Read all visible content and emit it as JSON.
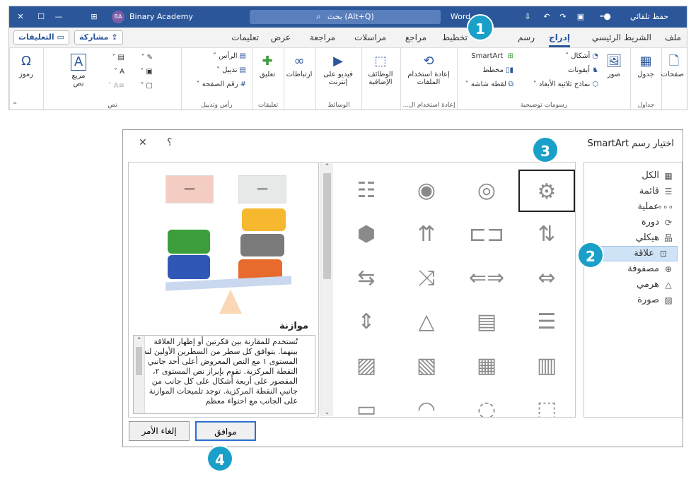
{
  "word": {
    "title_left": "حفظ تلقائي",
    "user_name": "Binary Academy",
    "user_initials": "BA",
    "search_placeholder": "(Alt+Q) بحث",
    "doc_name": "Word",
    "tabs": [
      "ملف",
      "الشريط الرئيسي",
      "إدراج",
      "رسم",
      "تخطيط",
      "مراجع",
      "مراسلات",
      "مراجعة",
      "عرض",
      "تعليمات"
    ],
    "share_label": "مشاركة",
    "comments_label": "التعليقات",
    "groups": {
      "pages": {
        "btn": "صفحات"
      },
      "tables": {
        "btn": "جدول",
        "label": "جداول"
      },
      "illustrations": {
        "pictures": "صور",
        "shapes": "أشكال",
        "icons": "أيقونات",
        "models3d": "نماذج ثلاثية الأبعاد",
        "smartart": "SmartArt",
        "chart": "مخطط",
        "screenshot": "لقطة شاشة",
        "label": "رسومات توضيحية"
      },
      "reuse": {
        "btn1": "إعادة استخدام",
        "btn2": "الملفات",
        "label": "إعادة استخدام ال..."
      },
      "addins": {
        "btn1": "الوظائف",
        "btn2": "الإضافية"
      },
      "media": {
        "btn1": "فيديو على",
        "btn2": "إنترنت",
        "label": "الوسائط"
      },
      "links": {
        "btn": "ارتباطات"
      },
      "comments": {
        "btn": "تعليق",
        "label": "تعليقات"
      },
      "headerfooter": {
        "header": "الرأس",
        "footer": "تذييل",
        "pagenum": "رقم الصفحة",
        "label": "رأس وتذييل"
      },
      "text": {
        "textbox1": "مربع",
        "textbox2": "نص",
        "label": "نص"
      },
      "symbols": {
        "btn": "رموز"
      }
    }
  },
  "dialog": {
    "title": "اختيار رسم SmartArt",
    "help": "؟",
    "close": "✕",
    "categories": [
      {
        "label": "الكل",
        "icon": "grid-icon"
      },
      {
        "label": "قائمة",
        "icon": "list-icon"
      },
      {
        "label": "عملية",
        "icon": "process-icon"
      },
      {
        "label": "دورة",
        "icon": "cycle-icon"
      },
      {
        "label": "هيكلي",
        "icon": "hierarchy-icon"
      },
      {
        "label": "علاقة",
        "icon": "relationship-icon"
      },
      {
        "label": "مصفوفة",
        "icon": "matrix-icon"
      },
      {
        "label": "هرمي",
        "icon": "pyramid-icon"
      },
      {
        "label": "صورة",
        "icon": "picture-icon"
      }
    ],
    "selected_category": "علاقة",
    "preview": {
      "name": "موازنة",
      "dash": "—",
      "description": "تُستخدم للمقارنة بين فكرتين أو إظهار العلاقة بينهما. يتوافق كل سطر من السطرين الأولين لنص المستوى ١ مع النص المعروض أعلى أحد جانبي النقطة المركزية. تقوم بإبراز نص المستوى ٢، المقصور على أربعة أشكال على كل جانب من جانبي النقطة المركزية. توجد تلميحات الموازنة على الجانب مع احتواء معظم"
    },
    "ok": "موافق",
    "cancel": "إلغاء الأمر"
  },
  "badges": [
    "1",
    "2",
    "3",
    "4"
  ],
  "colors": {
    "accent": "#2b579a",
    "badge": "#1aa0c8",
    "selected": "#cfe3f7"
  }
}
